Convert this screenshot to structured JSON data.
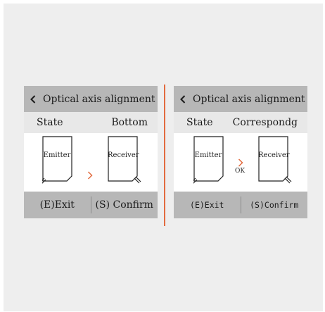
{
  "screens": [
    {
      "title": "Optical axis alignment",
      "state_label": "State",
      "state_value": "Bottom",
      "emitter_label": "Emitter",
      "receiver_label": "Receiver",
      "arrow_icon": "chevron-right",
      "ok_label": "",
      "exit_label": "(E)Exit",
      "confirm_label": "(S) Confirm"
    },
    {
      "title": "Optical axis alignment",
      "state_label": "State",
      "state_value": "Correspondg",
      "emitter_label": "Emitter",
      "receiver_label": "Receiver",
      "arrow_icon": "chevron-right",
      "ok_label": "OK",
      "exit_label": "(E)Exit",
      "confirm_label": "(S)Confirm"
    }
  ],
  "colors": {
    "accent": "#e26b3f",
    "bar_gray": "#b7b7b7",
    "state_bar": "#e8e8e8",
    "background": "#eeeeee"
  }
}
